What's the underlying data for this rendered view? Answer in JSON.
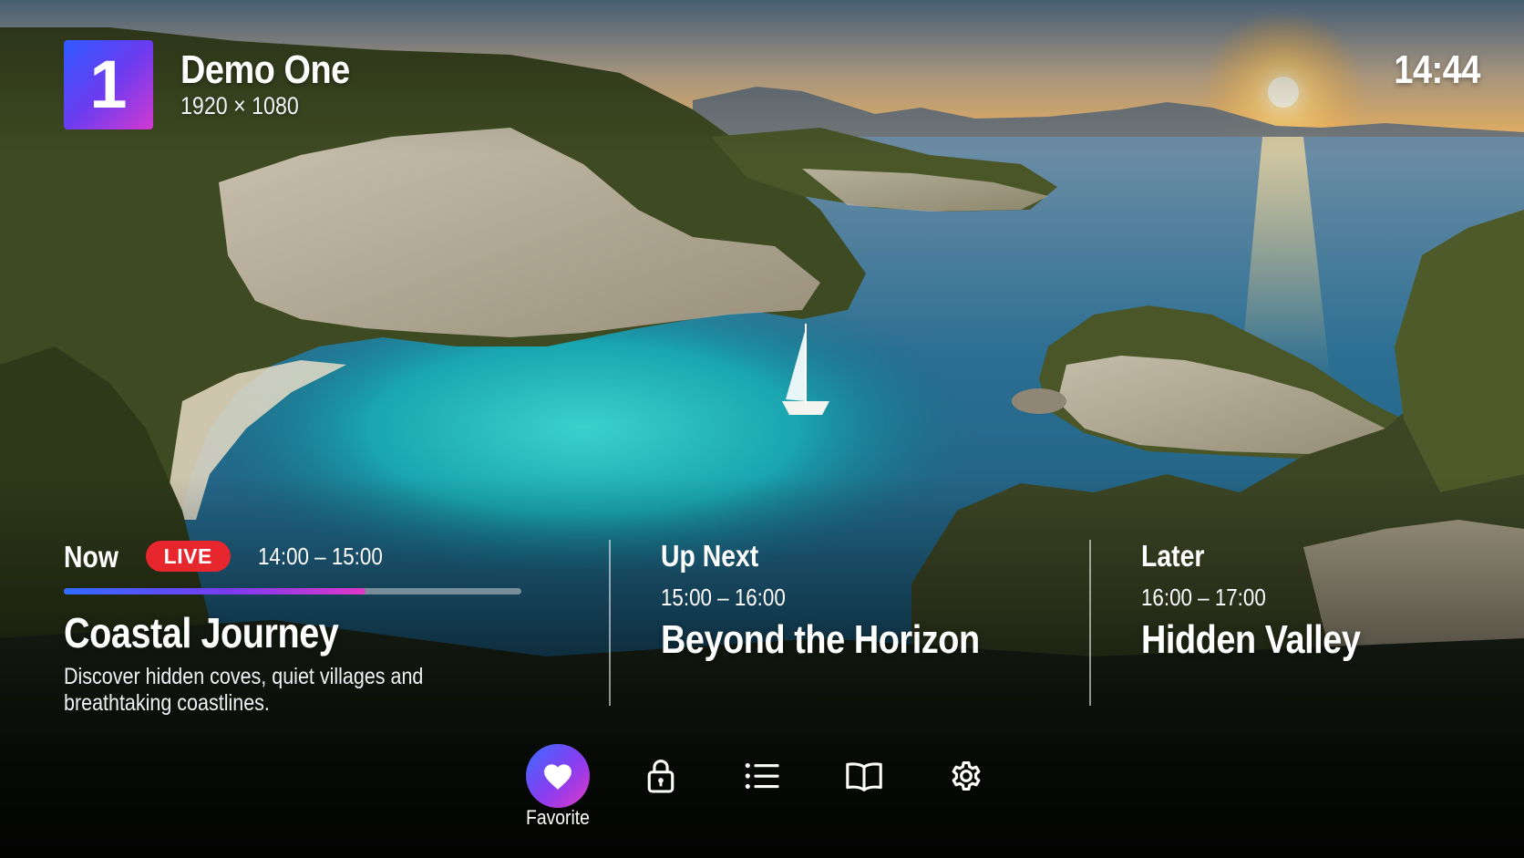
{
  "channel": {
    "number": "1",
    "name": "Demo One",
    "resolution": "1920 × 1080"
  },
  "clock": "14:44",
  "now": {
    "label": "Now",
    "live_badge": "LIVE",
    "time_range": "14:00 – 15:00",
    "progress_fraction": 0.66,
    "title": "Coastal Journey",
    "description": "Discover hidden coves, quiet villages and breathtaking coastlines."
  },
  "up_next": {
    "label": "Up Next",
    "time_range": "15:00 – 16:00",
    "title": "Beyond the Horizon"
  },
  "later": {
    "label": "Later",
    "time_range": "16:00 – 17:00",
    "title": "Hidden Valley"
  },
  "actions": [
    {
      "id": "favorite",
      "label": "Favorite",
      "icon": "heart-icon",
      "active": true
    },
    {
      "id": "lock",
      "label": "",
      "icon": "lock-icon",
      "active": false
    },
    {
      "id": "list",
      "label": "",
      "icon": "list-icon",
      "active": false
    },
    {
      "id": "guide",
      "label": "",
      "icon": "book-icon",
      "active": false
    },
    {
      "id": "settings",
      "label": "",
      "icon": "gear-icon",
      "active": false
    }
  ],
  "colors": {
    "accent_blue": "#2f6bff",
    "accent_purple": "#7a3cf0",
    "accent_pink": "#e038c8",
    "live_red": "#e8262e"
  }
}
